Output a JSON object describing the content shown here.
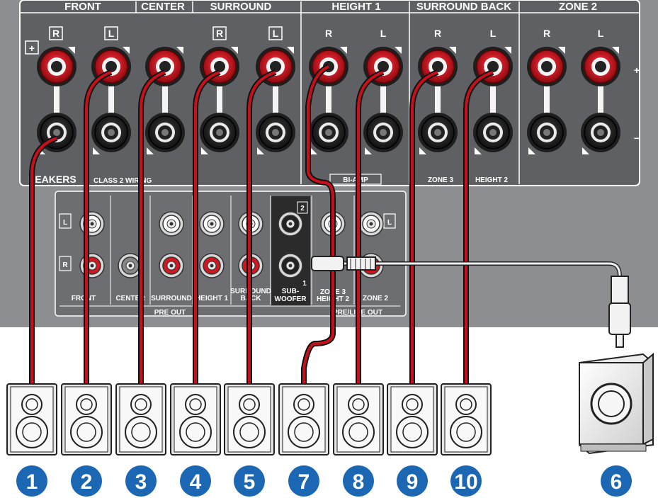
{
  "headers": {
    "front": "FRONT",
    "center": "CENTER",
    "surround": "SURROUND",
    "height1": "HEIGHT 1",
    "surround_back": "SURROUND BACK",
    "zone2": "ZONE 2"
  },
  "terminal_labels": {
    "r": "R",
    "l": "L",
    "plus": "+",
    "minus": "−"
  },
  "speakers_label": "PEAKERS",
  "class2_label": "CLASS 2 WIRING",
  "biamp_label": "BI-AMP",
  "zone3_label": "ZONE 3",
  "height2_label": "HEIGHT 2",
  "preout": {
    "front": "FRONT",
    "center": "CENTER",
    "surround": "SURROUND",
    "height1": "HEIGHT 1",
    "surround_back_1": "SURROUND",
    "surround_back_2": "BACK",
    "sub_1": "SUB-",
    "sub_2": "WOOFER",
    "sub_ch2": "2",
    "sub_ch1": "1",
    "zone3_1": "ZONE 3",
    "zone3_2": "HEIGHT 2",
    "zone2": "ZONE 2",
    "pre_out": "PRE OUT",
    "pre_line_out": "PRE/LINE OUT",
    "l": "L",
    "r": "R"
  },
  "speaker_numbers": [
    "1",
    "2",
    "3",
    "4",
    "5",
    "7",
    "8",
    "9",
    "10"
  ],
  "subwoofer_number": "6",
  "colors": {
    "panel": "#7d7f82",
    "panel_dark": "#5a5c5f",
    "red": "#d01820",
    "badge": "#1c67b3",
    "cable_red": "#c8101c"
  }
}
